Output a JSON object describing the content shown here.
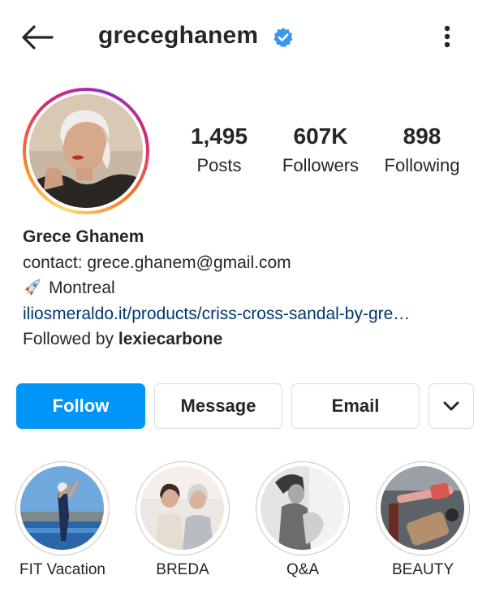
{
  "header": {
    "back_icon": "arrow-left-icon",
    "username": "greceghanem",
    "verified_icon": "verified-badge-icon",
    "more_icon": "more-vertical-icon"
  },
  "stats": {
    "posts": {
      "value": "1,495",
      "label": "Posts"
    },
    "followers": {
      "value": "607K",
      "label": "Followers"
    },
    "following": {
      "value": "898",
      "label": "Following"
    }
  },
  "bio": {
    "name": "Grece Ghanem",
    "contact": "contact: grece.ghanem@gmail.com",
    "location_icon": "rocket-icon",
    "location": "Montreal",
    "link": "iliosmeraldo.it/products/criss-cross-sandal-by-gre…",
    "followed_by_prefix": "Followed by ",
    "followed_by_user": "lexiecarbone"
  },
  "actions": {
    "follow": "Follow",
    "message": "Message",
    "email": "Email",
    "more_icon": "chevron-down-icon"
  },
  "highlights": [
    {
      "label": "FIT Vacation"
    },
    {
      "label": "BREDA"
    },
    {
      "label": "Q&A"
    },
    {
      "label": "BEAUTY"
    }
  ],
  "colors": {
    "primary_blue": "#0095f6",
    "link_blue": "#00376b",
    "verified_blue": "#3897f0",
    "text": "#262626",
    "border": "#dbdbdb"
  }
}
